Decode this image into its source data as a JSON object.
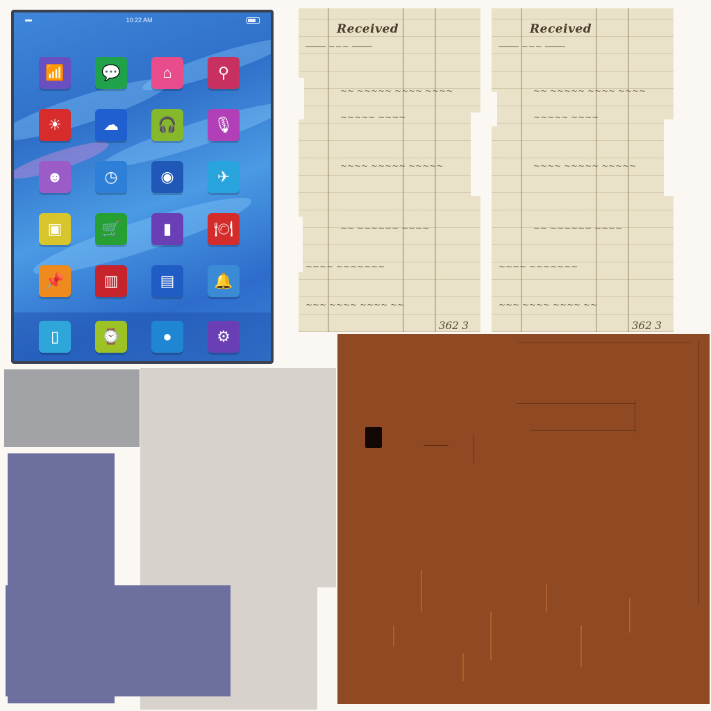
{
  "tablet": {
    "status_time": "10:22 AM",
    "apps": [
      {
        "name": "wifi-icon",
        "glyph": "📶",
        "bg": "#6a4fc0"
      },
      {
        "name": "chat-icon",
        "glyph": "💬",
        "bg": "#1fa24a"
      },
      {
        "name": "home-icon",
        "glyph": "⌂",
        "bg": "#e94c8b"
      },
      {
        "name": "search-icon",
        "glyph": "⚲",
        "bg": "#c8305f"
      },
      {
        "name": "weather-sun-icon",
        "glyph": "☀",
        "bg": "#d82c2c"
      },
      {
        "name": "cloud-icon",
        "glyph": "☁",
        "bg": "#1f5fcf"
      },
      {
        "name": "headphones-icon",
        "glyph": "🎧",
        "bg": "#86b82b"
      },
      {
        "name": "microphone-icon",
        "glyph": "🎙",
        "bg": "#b13fb8"
      },
      {
        "name": "user-icon",
        "glyph": "☻",
        "bg": "#9c5cc7"
      },
      {
        "name": "clock-icon",
        "glyph": "◷",
        "bg": "#2d7fd8"
      },
      {
        "name": "camera-icon",
        "glyph": "◉",
        "bg": "#2058b8"
      },
      {
        "name": "airplane-icon",
        "glyph": "✈",
        "bg": "#2aa4dd"
      },
      {
        "name": "tv-icon",
        "glyph": "▣",
        "bg": "#d7c52b"
      },
      {
        "name": "cart-icon",
        "glyph": "🛒",
        "bg": "#27a033"
      },
      {
        "name": "equalizer-icon",
        "glyph": "▮",
        "bg": "#6a3fb5"
      },
      {
        "name": "dining-icon",
        "glyph": "🍽",
        "bg": "#d42b2b"
      },
      {
        "name": "pushpin-icon",
        "glyph": "📌",
        "bg": "#ee8a1e"
      },
      {
        "name": "book-icon",
        "glyph": "▥",
        "bg": "#c6232c"
      },
      {
        "name": "film-icon",
        "glyph": "▤",
        "bg": "#1f5cc4"
      },
      {
        "name": "bell-icon",
        "glyph": "🔔",
        "bg": "#3b8ad6"
      }
    ],
    "dock": [
      {
        "name": "phone-icon",
        "glyph": "▯",
        "bg": "#2fa6d9"
      },
      {
        "name": "watch-icon",
        "glyph": "⌚",
        "bg": "#9cc226"
      },
      {
        "name": "circle-icon",
        "glyph": "●",
        "bg": "#1f86d4"
      },
      {
        "name": "settings-icon",
        "glyph": "⚙",
        "bg": "#6a3fb5"
      }
    ]
  },
  "ledgers": [
    {
      "title": "Received",
      "total": "362 3"
    },
    {
      "title": "Received",
      "total": "362 3"
    }
  ],
  "colors": {
    "gray_block": "#a2a3a7",
    "beige_block": "#d7d2cc",
    "purple_block": "#6d6f9f",
    "leather_block": "#8f4a23"
  }
}
